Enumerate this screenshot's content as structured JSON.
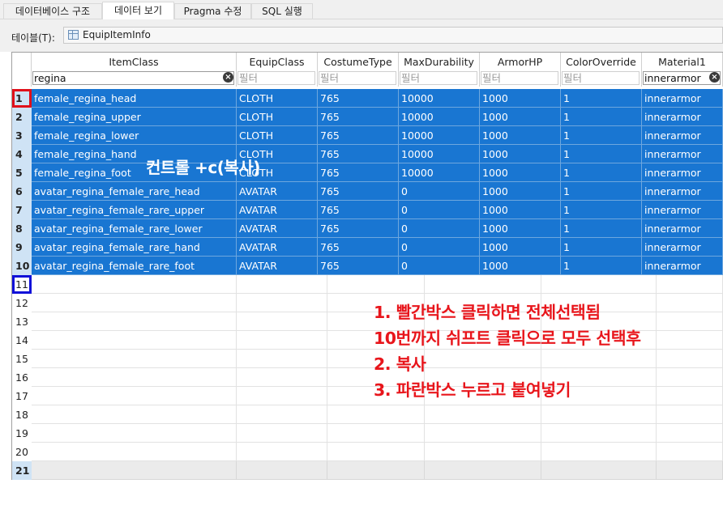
{
  "tabs": [
    {
      "label": "데이터베이스 구조"
    },
    {
      "label": "데이터 보기"
    },
    {
      "label": "Pragma 수정"
    },
    {
      "label": "SQL 실행"
    }
  ],
  "table_selector": {
    "label": "테이블(T):",
    "value": "EquipItemInfo",
    "icon": "table-icon"
  },
  "columns": [
    "ItemClass",
    "EquipClass",
    "CostumeType",
    "MaxDurability",
    "ArmorHP",
    "ColorOverride",
    "Material1"
  ],
  "filters": [
    "regina",
    "필터",
    "필터",
    "필터",
    "필터",
    "필터",
    "innerarmor"
  ],
  "rows": [
    {
      "num": "1",
      "cells": [
        "female_regina_head",
        "CLOTH",
        "765",
        "10000",
        "1000",
        "1",
        "innerarmor"
      ]
    },
    {
      "num": "2",
      "cells": [
        "female_regina_upper",
        "CLOTH",
        "765",
        "10000",
        "1000",
        "1",
        "innerarmor"
      ]
    },
    {
      "num": "3",
      "cells": [
        "female_regina_lower",
        "CLOTH",
        "765",
        "10000",
        "1000",
        "1",
        "innerarmor"
      ]
    },
    {
      "num": "4",
      "cells": [
        "female_regina_hand",
        "CLOTH",
        "765",
        "10000",
        "1000",
        "1",
        "innerarmor"
      ]
    },
    {
      "num": "5",
      "cells": [
        "female_regina_foot",
        "CLOTH",
        "765",
        "10000",
        "1000",
        "1",
        "innerarmor"
      ]
    },
    {
      "num": "6",
      "cells": [
        "avatar_regina_female_rare_head",
        "AVATAR",
        "765",
        "0",
        "1000",
        "1",
        "innerarmor"
      ]
    },
    {
      "num": "7",
      "cells": [
        "avatar_regina_female_rare_upper",
        "AVATAR",
        "765",
        "0",
        "1000",
        "1",
        "innerarmor"
      ]
    },
    {
      "num": "8",
      "cells": [
        "avatar_regina_female_rare_lower",
        "AVATAR",
        "765",
        "0",
        "1000",
        "1",
        "innerarmor"
      ]
    },
    {
      "num": "9",
      "cells": [
        "avatar_regina_female_rare_hand",
        "AVATAR",
        "765",
        "0",
        "1000",
        "1",
        "innerarmor"
      ]
    },
    {
      "num": "10",
      "cells": [
        "avatar_regina_female_rare_foot",
        "AVATAR",
        "765",
        "0",
        "1000",
        "1",
        "innerarmor"
      ]
    }
  ],
  "empty_rows": [
    "11",
    "12",
    "13",
    "14",
    "15",
    "16",
    "17",
    "18",
    "19",
    "20"
  ],
  "new_row": "21",
  "overlay_text": "컨트롤 +c(복사)",
  "instructions": [
    "1. 빨간박스 클릭하면 전체선택됨",
    "10번까지 쉬프트 클릭으로 모두 선택후",
    "2. 복사",
    "3. 파란박스 누르고 붙여넣기"
  ],
  "colors": {
    "selection": "#1976d2",
    "annotation_red": "#e8151b",
    "annotation_blue": "#1010d8"
  }
}
